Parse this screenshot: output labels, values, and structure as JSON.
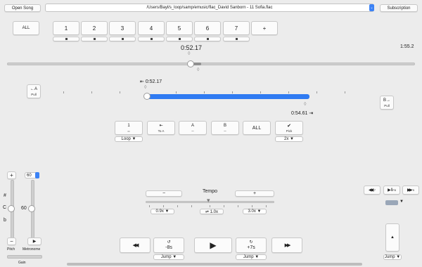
{
  "top": {
    "open_song": "Open Song",
    "path": "/Users/Bayl/s_loop/samp/emusic/flac_David Sanborn - 11 Sofia.flac",
    "subscription": "Subscription"
  },
  "loops": {
    "all": "ALL",
    "slots": [
      "1",
      "2",
      "3",
      "4",
      "5",
      "6",
      "7"
    ],
    "add": "+"
  },
  "position": {
    "time": "0:52.17",
    "duration": "1:55.2"
  },
  "loop": {
    "start_time": "0:52.17",
    "end_time": "0:54.61",
    "a_button": "←A",
    "a_sub": "Pull",
    "b_button": "B→",
    "b_sub": "Pull",
    "start_icon": "⇤",
    "end_icon": "⇥"
  },
  "controls": [
    {
      "icon": "1",
      "sub": "═"
    },
    {
      "icon": "⇤",
      "sub": "To A"
    },
    {
      "icon": "A",
      "sub": "─"
    },
    {
      "icon": "B",
      "sub": "─"
    },
    {
      "icon": "ALL",
      "sub": ""
    },
    {
      "icon": "✔",
      "sub": "Pick"
    }
  ],
  "loop_select": "Loop ▼",
  "rate_select": "2x ▼",
  "pitch": {
    "value": "60",
    "display": "60",
    "plus": "+",
    "minus": "−",
    "sharp": "#",
    "note": "C",
    "flat": "b",
    "label": "Pitch",
    "metronome_label": "Metronome",
    "play_icon": "▶",
    "gain_label": "Gain"
  },
  "tempo": {
    "minus": "−",
    "label": "Tempo",
    "plus": "+",
    "slow": "0.9x ▼",
    "reset": "⇌ 1.0x",
    "fast": "3.0x ▼"
  },
  "transport": {
    "rewind": "◀◀",
    "back": "-8s",
    "back_icon": "↺",
    "play": "▶",
    "forward": "+7s",
    "forward_icon": "↻",
    "ffwd": "▶▶",
    "jump_left": "Jump ▼",
    "jump_right": "Jump ▼"
  },
  "right": {
    "f7": "◀◀",
    "f7_key": "F7",
    "f8": "▶‖",
    "f8_key": "F8",
    "f9": "▶▶",
    "f9_key": "F9",
    "up": "▲",
    "jump": "Jump ▼"
  }
}
